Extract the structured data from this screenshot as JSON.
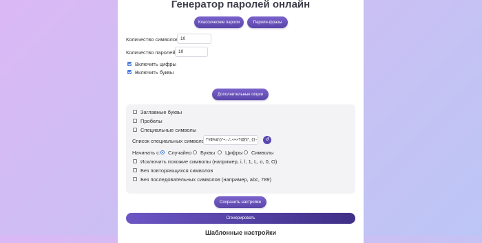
{
  "page": {
    "title": "Генератор паролей онлайн",
    "tabs": [
      {
        "label": "Классические пароли"
      },
      {
        "label": "Пароли-фразы"
      }
    ]
  },
  "form": {
    "length_label": "Количество символов:",
    "length_value": "10",
    "count_label": "Количество паролей:",
    "count_value": "10",
    "include_digits_label": "Включить цифры",
    "include_digits_checked": true,
    "include_letters_label": "Включить буквы",
    "include_letters_checked": true,
    "more_options_label": "Дополнительные опции"
  },
  "advanced": {
    "uppercase_label": "Заглавные буквы",
    "spaces_label": "Пробелы",
    "special_label": "Специальные символы",
    "special_list_label": "Список специальных символов:",
    "special_list_value": "!\"#$%&'()*+,-./:;<=>?@[\\]^_{|}~",
    "start_with_label": "Начинать с:",
    "start_options": [
      "Случайно",
      "Буквы",
      "Цифры",
      "Символы"
    ],
    "start_selected": "Случайно",
    "exclude_similar_label": "Исключить похожие символы (например, i, l, 1, L, o, 0, O)",
    "no_repeat_label": "Без повторяющихся символов",
    "no_sequential_label": "Без последовательных символов (например, abc, 789)"
  },
  "actions": {
    "save_label": "Сохранить настройки",
    "generate_label": "Сгенерировать"
  },
  "templates": {
    "title": "Шаблонные настройки"
  },
  "colors": {
    "accent": "#5a45a8",
    "checkbox": "#4a7de0"
  }
}
